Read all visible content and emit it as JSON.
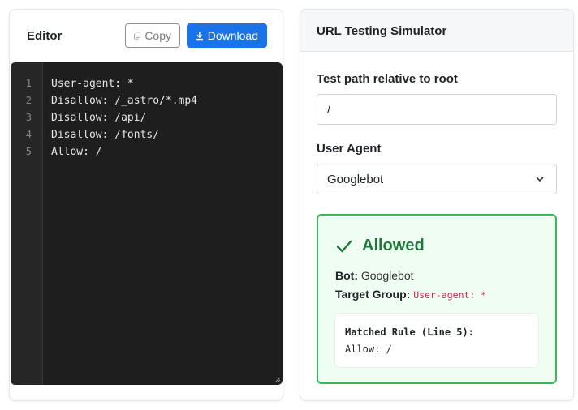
{
  "editor": {
    "title": "Editor",
    "copy_label": "Copy",
    "download_label": "Download",
    "lines": [
      {
        "num": "1",
        "text": "User-agent: *"
      },
      {
        "num": "2",
        "text": "Disallow: /_astro/*.mp4"
      },
      {
        "num": "3",
        "text": "Disallow: /api/"
      },
      {
        "num": "4",
        "text": "Disallow: /fonts/"
      },
      {
        "num": "5",
        "text": "Allow: /"
      }
    ]
  },
  "simulator": {
    "title": "URL Testing Simulator",
    "path_label": "Test path relative to root",
    "path_value": "/",
    "agent_label": "User Agent",
    "agent_value": "Googlebot",
    "result": {
      "status": "Allowed",
      "bot_label": "Bot:",
      "bot_value": "Googlebot",
      "group_label": "Target Group:",
      "group_value": "User-agent: *",
      "matched_title": "Matched Rule (Line 5):",
      "matched_rule": "Allow: /"
    }
  },
  "colors": {
    "download_bg": "#1a73e8",
    "allowed_green": "#1e7a3c",
    "allowed_border": "#3cb55e",
    "editor_bg": "#1e1e1e"
  },
  "icons": {
    "copy": "copy-icon",
    "download": "download-icon",
    "check": "check-icon",
    "chevron": "chevron-down-icon"
  }
}
